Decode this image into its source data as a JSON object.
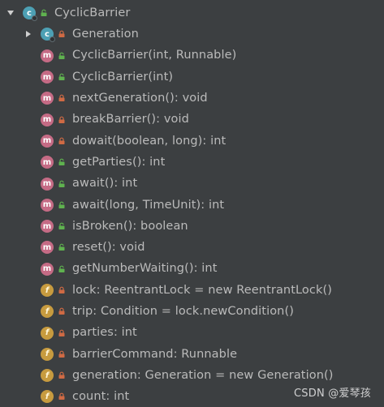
{
  "colors": {
    "background": "#3c3f41",
    "text": "#bbbbbb",
    "class_badge": "#4da0b4",
    "method_badge": "#c56b85",
    "field_badge": "#c79b3f",
    "public_visibility": "#5fb24f",
    "private_visibility": "#cf6a44"
  },
  "tree": {
    "root": {
      "label": "CyclicBarrier",
      "expanded": true,
      "icon": "class-icon",
      "visibility_icon": "public-icon"
    },
    "items": [
      {
        "label": "Generation",
        "kind": "class",
        "visibility": "private",
        "expandable": true
      },
      {
        "label": "CyclicBarrier(int, Runnable)",
        "kind": "method",
        "visibility": "public"
      },
      {
        "label": "CyclicBarrier(int)",
        "kind": "method",
        "visibility": "public"
      },
      {
        "label": "nextGeneration(): void",
        "kind": "method",
        "visibility": "private"
      },
      {
        "label": "breakBarrier(): void",
        "kind": "method",
        "visibility": "private"
      },
      {
        "label": "dowait(boolean, long): int",
        "kind": "method",
        "visibility": "private"
      },
      {
        "label": "getParties(): int",
        "kind": "method",
        "visibility": "public"
      },
      {
        "label": "await(): int",
        "kind": "method",
        "visibility": "public"
      },
      {
        "label": "await(long, TimeUnit): int",
        "kind": "method",
        "visibility": "public"
      },
      {
        "label": "isBroken(): boolean",
        "kind": "method",
        "visibility": "public"
      },
      {
        "label": "reset(): void",
        "kind": "method",
        "visibility": "public"
      },
      {
        "label": "getNumberWaiting(): int",
        "kind": "method",
        "visibility": "public"
      },
      {
        "label": "lock: ReentrantLock = new ReentrantLock()",
        "kind": "field",
        "visibility": "private"
      },
      {
        "label": "trip: Condition = lock.newCondition()",
        "kind": "field",
        "visibility": "private"
      },
      {
        "label": "parties: int",
        "kind": "field",
        "visibility": "private"
      },
      {
        "label": "barrierCommand: Runnable",
        "kind": "field",
        "visibility": "private"
      },
      {
        "label": "generation: Generation = new Generation()",
        "kind": "field",
        "visibility": "private"
      },
      {
        "label": "count: int",
        "kind": "field",
        "visibility": "private"
      }
    ]
  },
  "watermark": "CSDN @爱琴孩"
}
